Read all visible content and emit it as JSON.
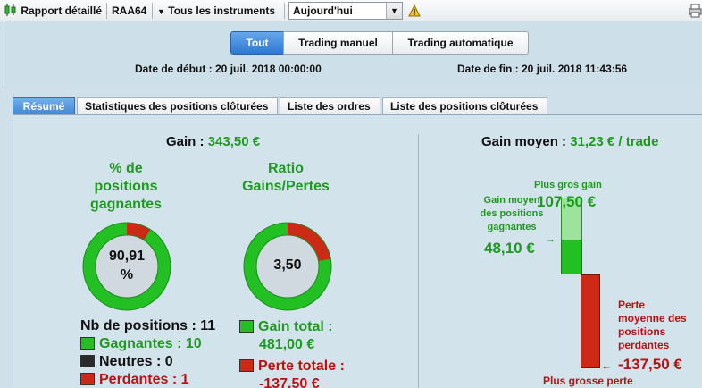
{
  "toolbar": {
    "report_label": "Rapport détaillé",
    "account": "RAA64",
    "instruments_label": "Tous les instruments",
    "period_value": "Aujourd'hui"
  },
  "filters": {
    "segments": [
      "Tout",
      "Trading manuel",
      "Trading automatique"
    ],
    "active_segment": "Tout",
    "start_date_label": "Date de début : 20 juil. 2018 00:00:00",
    "end_date_label": "Date de fin : 20 juil. 2018 11:43:56"
  },
  "tabs": [
    "Résumé",
    "Statistiques des positions clôturées",
    "Liste des ordres",
    "Liste des positions clôturées"
  ],
  "summary": {
    "gain_label": "Gain :",
    "gain_value": "343,50 €",
    "win_pct_title_lines": [
      "% de",
      "positions",
      "gagnantes"
    ],
    "win_pct_value_lines": [
      "90,91",
      "%"
    ],
    "win_pct": 90.91,
    "ratio_title_lines": [
      "Ratio",
      "Gains/Pertes"
    ],
    "ratio_value": "3,50",
    "ratio_green_fraction": 0.7778,
    "nb_positions_label": "Nb de positions : 11",
    "winners_label": "Gagnantes : 10",
    "neutral_label": "Neutres : 0",
    "losers_label": "Perdantes : 1",
    "total_gain_lines": [
      "Gain total :",
      "481,00 €"
    ],
    "total_loss_lines": [
      "Perte totale :",
      "-137,50 €"
    ]
  },
  "average": {
    "title_label": "Gain moyen :",
    "title_value": "31,23 € / trade",
    "max_gain_label": "Plus gros gain",
    "max_gain_value": "107,50 €",
    "avg_win_label_lines": [
      "Gain moyen",
      "des positions",
      "gagnantes"
    ],
    "avg_win_value": "48,10 €",
    "avg_loss_label_lines": [
      "Perte",
      "moyenne des",
      "positions",
      "perdantes"
    ],
    "avg_loss_value": "-137,50 €",
    "max_loss_label": "Plus grosse perte"
  },
  "colors": {
    "accent_blue": "#2f78d2",
    "gain_green": "#1e9a1e",
    "bar_green": "#22c022",
    "bar_light_green": "#9de29d",
    "loss_red": "#bb1111",
    "bar_red": "#cc2a16"
  }
}
